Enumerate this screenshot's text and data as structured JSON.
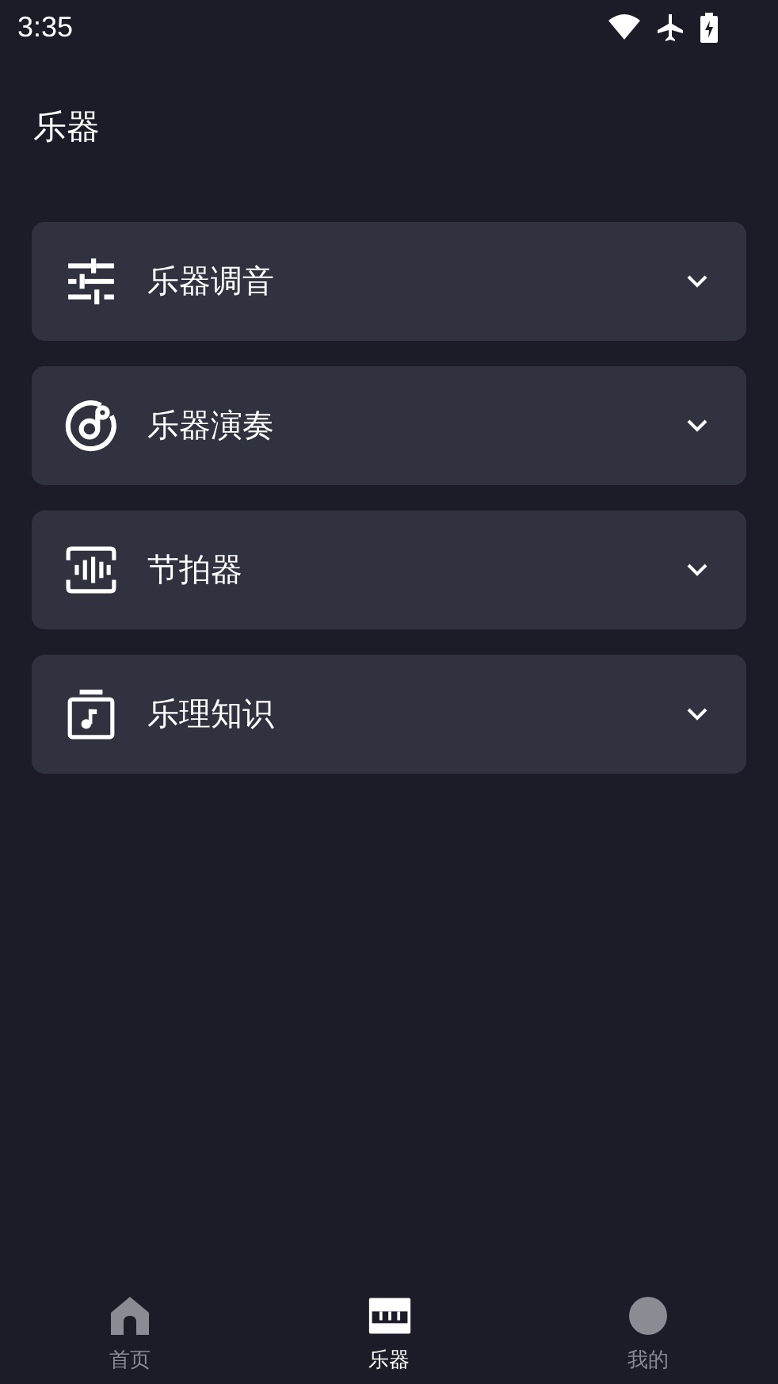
{
  "status_bar": {
    "time": "3:35"
  },
  "title": "乐器",
  "sections": [
    {
      "kind": "tuner",
      "label": "乐器调音",
      "expanded": false
    },
    {
      "kind": "play",
      "label": "乐器演奏",
      "expanded": false
    },
    {
      "kind": "metronome",
      "label": "节拍器",
      "expanded": false
    },
    {
      "kind": "theory",
      "label": "乐理知识",
      "expanded": false
    }
  ],
  "bottom_nav": [
    {
      "kind": "home",
      "label": "首页",
      "selected": false
    },
    {
      "kind": "instrument",
      "label": "乐器",
      "selected": true
    },
    {
      "kind": "profile",
      "label": "我的",
      "selected": false
    }
  ]
}
